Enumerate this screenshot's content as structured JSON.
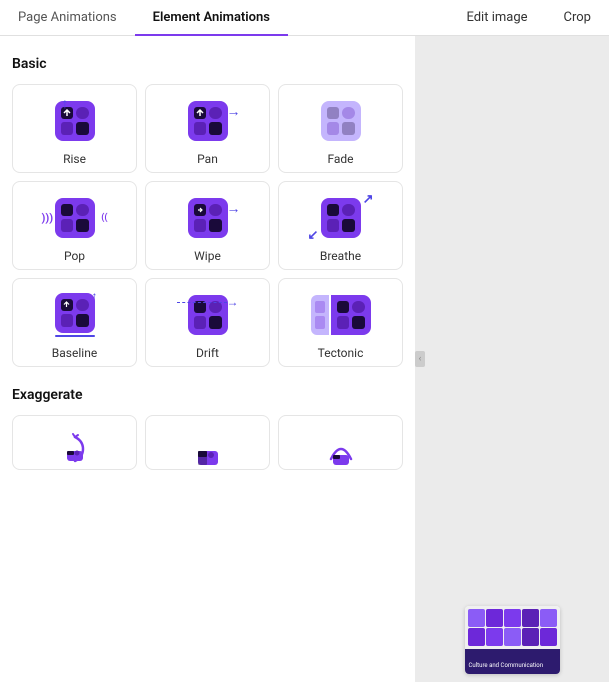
{
  "topNav": {
    "tabs": [
      {
        "id": "page-animations",
        "label": "Page Animations",
        "active": false
      },
      {
        "id": "element-animations",
        "label": "Element Animations",
        "active": true
      }
    ],
    "rightTabs": [
      {
        "id": "edit-image",
        "label": "Edit image"
      },
      {
        "id": "crop",
        "label": "Crop"
      }
    ]
  },
  "sections": [
    {
      "id": "basic",
      "heading": "Basic",
      "animations": [
        {
          "id": "rise",
          "label": "Rise"
        },
        {
          "id": "pan",
          "label": "Pan"
        },
        {
          "id": "fade",
          "label": "Fade"
        },
        {
          "id": "pop",
          "label": "Pop"
        },
        {
          "id": "wipe",
          "label": "Wipe"
        },
        {
          "id": "breathe",
          "label": "Breathe"
        },
        {
          "id": "baseline",
          "label": "Baseline"
        },
        {
          "id": "drift",
          "label": "Drift"
        },
        {
          "id": "tectonic",
          "label": "Tectonic"
        }
      ]
    },
    {
      "id": "exaggerate",
      "heading": "Exaggerate",
      "animations": [
        {
          "id": "exag1",
          "label": ""
        },
        {
          "id": "exag2",
          "label": ""
        },
        {
          "id": "exag3",
          "label": ""
        }
      ]
    }
  ],
  "preview": {
    "label": "Culture and Communication"
  },
  "colors": {
    "purple": "#7c3aed",
    "lightPurple": "#c4b5fd",
    "accent": "#4f46e5"
  }
}
